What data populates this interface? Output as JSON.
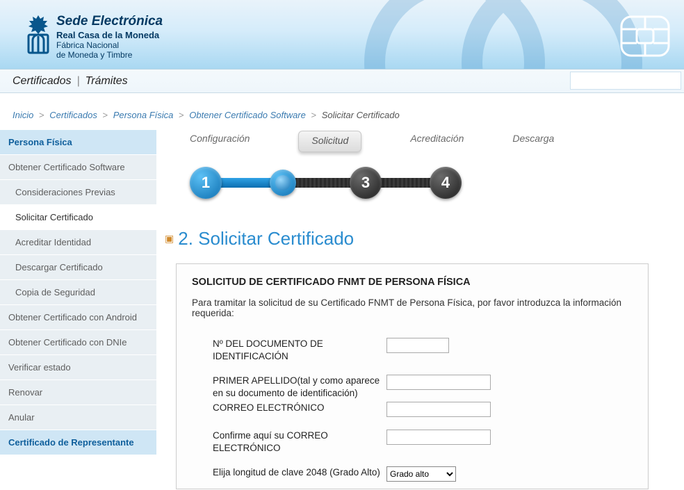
{
  "header": {
    "site_title": "Sede Electrónica",
    "sub1": "Real Casa de la Moneda",
    "sub2": "Fábrica Nacional",
    "sub3": "de Moneda y Timbre"
  },
  "nav": {
    "item1": "Certificados",
    "item2": "Trámites"
  },
  "breadcrumb": {
    "home": "Inicio",
    "l1": "Certificados",
    "l2": "Persona Física",
    "l3": "Obtener Certificado Software",
    "current": "Solicitar Certificado"
  },
  "sidebar": {
    "head": "Persona Física",
    "items": [
      "Obtener Certificado Software",
      "Consideraciones Previas",
      "Solicitar Certificado",
      "Acreditar Identidad",
      "Descargar Certificado",
      "Copia de Seguridad",
      "Obtener Certificado con Android",
      "Obtener Certificado con DNIe",
      "Verificar estado",
      "Renovar",
      "Anular"
    ],
    "footer": "Certificado de Representante"
  },
  "steps": {
    "labels": [
      "Configuración",
      "Solicitud",
      "Acreditación",
      "Descarga"
    ],
    "numbers": [
      "1",
      "",
      "3",
      "4"
    ]
  },
  "page": {
    "title": "2. Solicitar Certificado",
    "form_heading": "SOLICITUD DE CERTIFICADO FNMT DE PERSONA FÍSICA",
    "intro": "Para tramitar la solicitud de su Certificado FNMT de Persona Física, por favor introduzca la información requerida:",
    "labels": {
      "doc": "Nº DEL DOCUMENTO DE IDENTIFICACIÓN",
      "apellido": "PRIMER APELLIDO(tal y como aparece en su documento de identificación)",
      "correo": "CORREO ELECTRÓNICO",
      "correo2": "Confirme aquí su CORREO ELECTRÓNICO",
      "clave": "Elija longitud de clave  2048  (Grado Alto)"
    },
    "select_option": "Grado alto"
  }
}
